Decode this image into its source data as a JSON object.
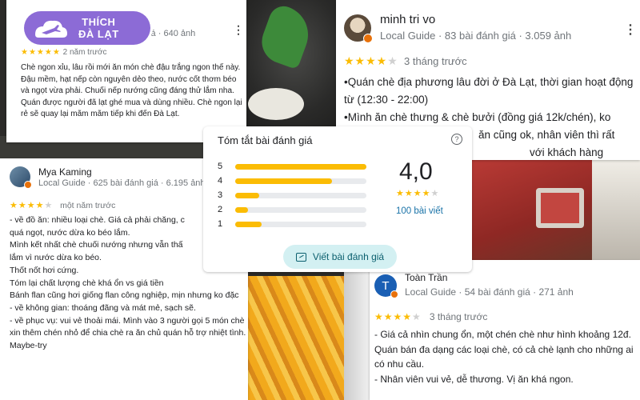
{
  "brand": {
    "line1": "THÍCH",
    "line2": "ĐÀ LẠT",
    "color": "#8c6bd6"
  },
  "card1": {
    "meta_partial": "giá · 640 ảnh",
    "stars": "★★★★★",
    "time": "2 năm trước",
    "text": "Chè ngon xỉu, lâu rồi mới ăn món chè đậu trắng ngon thế này. Đậu mềm, hạt nếp còn nguyên dẻo theo, nước cốt thơm béo và ngọt vừa phải. Chuối nếp nướng cũng đáng thử lắm nha. Quán được người đã lạt ghé mua và dùng nhiều. Chè ngon lại rẻ sẽ quay lại mãm mãm tiếp khi đến Đà Lạt."
  },
  "card2": {
    "name": "minh tri vo",
    "meta": "Local Guide · 83 bài đánh giá · 3.059 ảnh",
    "stars_on": "★★★★",
    "stars_off": "★",
    "time": "3 tháng trước",
    "lines": [
      "•Quán chè địa phương lâu đời ở Đà Lạt, thời gian hoạt động từ (12:30 - 22:00)",
      "•Mình ăn chè thưng & chè bưởi (đồng giá 12k/chén), ko",
      "ăn cũng ok, nhân viên thì rất",
      "với khách hàng"
    ]
  },
  "card3": {
    "name": "Mya Kaming",
    "meta": "Local Guide · 625 bài đánh giá · 6.195 ảnh",
    "stars_on": "★★★★",
    "stars_off": "★",
    "time": "một năm trước",
    "lines": [
      "- về đồ ăn: nhiều loại chè. Giá cả phải chăng, c",
      "quá ngọt, nước dừa ko béo lắm.",
      "Mình kết nhất chè chuối nướng nhưng vẫn thấ",
      "lắm vì nước dừa ko béo.",
      "Thốt nốt hơi cứng.",
      "Tóm lại chất lượng chè khá ổn vs giá tiền",
      "Bánh flan cũng hơi giống flan công nghiệp, mịn nhưng ko đặc",
      "- về không gian: thoáng đãng và mát mẻ, sạch sẽ.",
      "- về phục vụ: vui vẻ thoải mái. Mình vào 3 người gọi 5 món chè xin thêm chén nhỏ để chia chè ra ăn chủ quán hỗ trợ nhiệt tình.",
      "Maybe-try"
    ]
  },
  "card4": {
    "avatar_letter": "T",
    "name": "Toàn Trần",
    "meta": "Local Guide · 54 bài đánh giá · 271 ảnh",
    "stars_on": "★★★★",
    "stars_off": "★",
    "time": "3 tháng trước",
    "lines": [
      "- Giá cả nhìn chung ổn, một chén chè như hình khoảng 12đ. Quán bán đa dạng các loại chè, có cả chè lạnh cho những ai có nhu cầu.",
      "- Nhân viên vui vẻ, dễ thương. Vị ăn khá ngon."
    ]
  },
  "summary": {
    "title": "Tóm tắt bài đánh giá",
    "help_glyph": "?",
    "average": "4,0",
    "stars_on": "★★★★",
    "stars_off": "★",
    "count": "100 bài viết",
    "write_label": "Viết bài đánh giá",
    "bars": [
      {
        "label": "5",
        "fraction": 1.0
      },
      {
        "label": "4",
        "fraction": 0.74
      },
      {
        "label": "3",
        "fraction": 0.18
      },
      {
        "label": "2",
        "fraction": 0.1
      },
      {
        "label": "1",
        "fraction": 0.2
      }
    ]
  },
  "icons": {
    "menu": "more-vert-icon",
    "help": "help-circle-icon",
    "write": "rate-review-icon"
  },
  "colors": {
    "star": "#fbbc04",
    "bar_track": "#e8eaed",
    "write_button_bg": "#d3f0f2",
    "link": "#1a73a8"
  }
}
